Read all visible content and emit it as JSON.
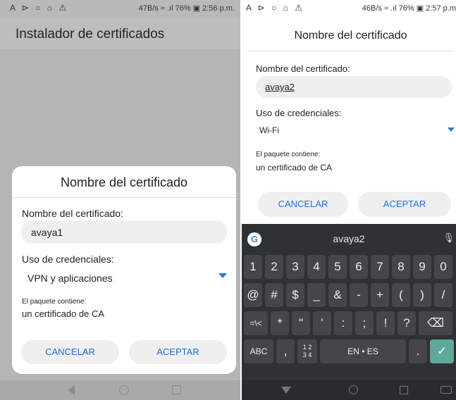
{
  "left": {
    "status": {
      "icons": "A ⊳ ○ ⌂ ⚠",
      "right": "47B/s ≈ .ıl 76% ▣ 2:56 p.m."
    },
    "app_title": "Instalador de certificados",
    "dialog": {
      "title": "Nombre del certificado",
      "name_label": "Nombre del certificado:",
      "name_value": "avaya1",
      "usage_label": "Uso de credenciales:",
      "usage_value": "VPN y aplicaciones",
      "pkg_label": "El paquete contiene:",
      "pkg_value": "un certificado de CA",
      "cancel": "CANCELAR",
      "accept": "ACEPTAR"
    }
  },
  "right": {
    "status": {
      "icons": "A ⊳ ○ ⌂ ⚠",
      "right": "46B/s ≈ .ıl 76% ▣ 2:57 p.m"
    },
    "dialog": {
      "title": "Nombre del certificado",
      "name_label": "Nombre del certificado:",
      "name_value": "avaya2",
      "usage_label": "Uso de credenciales:",
      "usage_value": "Wi-Fi",
      "pkg_label": "El paquete contiene:",
      "pkg_value": "un certificado de CA",
      "cancel": "CANCELAR",
      "accept": "ACEPTAR"
    },
    "keyboard": {
      "g_letter": "G",
      "suggestion": "avaya2",
      "mic": "🎙",
      "row1": [
        "1",
        "2",
        "3",
        "4",
        "5",
        "6",
        "7",
        "8",
        "9",
        "0"
      ],
      "row2": [
        "@",
        "#",
        "$",
        "_",
        "&",
        "-",
        "+",
        "(",
        ")",
        "/"
      ],
      "row3": [
        "=\\<",
        "*",
        "\"",
        "'",
        ":",
        ";",
        "!",
        "?",
        "⌫"
      ],
      "row4": {
        "abc": "ABC",
        "comma": ",",
        "fraction_top": "1 2",
        "fraction_bottom": "3 4",
        "space": "EN • ES",
        "period": ".",
        "enter": "✓"
      }
    }
  }
}
